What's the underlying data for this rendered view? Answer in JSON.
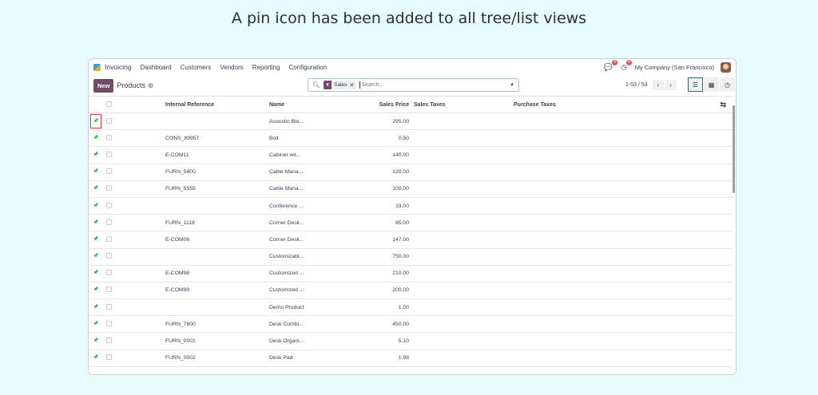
{
  "caption": "A pin icon has been added to all tree/list views",
  "navbar": {
    "app_name": "Invoicing",
    "menu": [
      "Dashboard",
      "Customers",
      "Vendors",
      "Reporting",
      "Configuration"
    ],
    "chat_badge": "4",
    "activity_badge": "4",
    "company": "My Company (San Francisco)"
  },
  "control": {
    "new_label": "New",
    "breadcrumb": "Products",
    "facet_label": "Sales",
    "search_placeholder": "Search...",
    "pager": "1-53 / 53"
  },
  "table": {
    "headers": {
      "ref": "Internal Reference",
      "name": "Name",
      "price": "Sales Price",
      "stax": "Sales Taxes",
      "ptax": "Purchase Taxes"
    },
    "rows": [
      {
        "ref": "",
        "name": "Acoustic Blo...",
        "price": "295.00"
      },
      {
        "ref": "CONS_89957",
        "name": "Bolt",
        "price": "0.50"
      },
      {
        "ref": "E-COM11",
        "name": "Cabinet wit...",
        "price": "140.00"
      },
      {
        "ref": "FURN_5800",
        "name": "Cable Mana...",
        "price": "120.00"
      },
      {
        "ref": "FURN_5555",
        "name": "Cable Mana...",
        "price": "100.00"
      },
      {
        "ref": "",
        "name": "Conference ...",
        "price": "33.00"
      },
      {
        "ref": "FURN_1118",
        "name": "Corner Desk...",
        "price": "85.00"
      },
      {
        "ref": "E-COM06",
        "name": "Corner Desk...",
        "price": "147.00"
      },
      {
        "ref": "",
        "name": "Customizabl...",
        "price": "750.00"
      },
      {
        "ref": "E-COM98",
        "name": "Customized ...",
        "price": "210.00"
      },
      {
        "ref": "E-COM99",
        "name": "Customized ...",
        "price": "200.00"
      },
      {
        "ref": "",
        "name": "Demo Product",
        "price": "1.00"
      },
      {
        "ref": "FURN_7800",
        "name": "Desk Combi...",
        "price": "450.00"
      },
      {
        "ref": "FURN_0001",
        "name": "Desk Organi...",
        "price": "5.10"
      },
      {
        "ref": "FURN_0002",
        "name": "Desk Pad",
        "price": "1.98"
      }
    ]
  },
  "colors": {
    "brand": "#714b67",
    "pin": "#28a745",
    "highlight": "#e03131",
    "background": "#e8fbfd"
  }
}
